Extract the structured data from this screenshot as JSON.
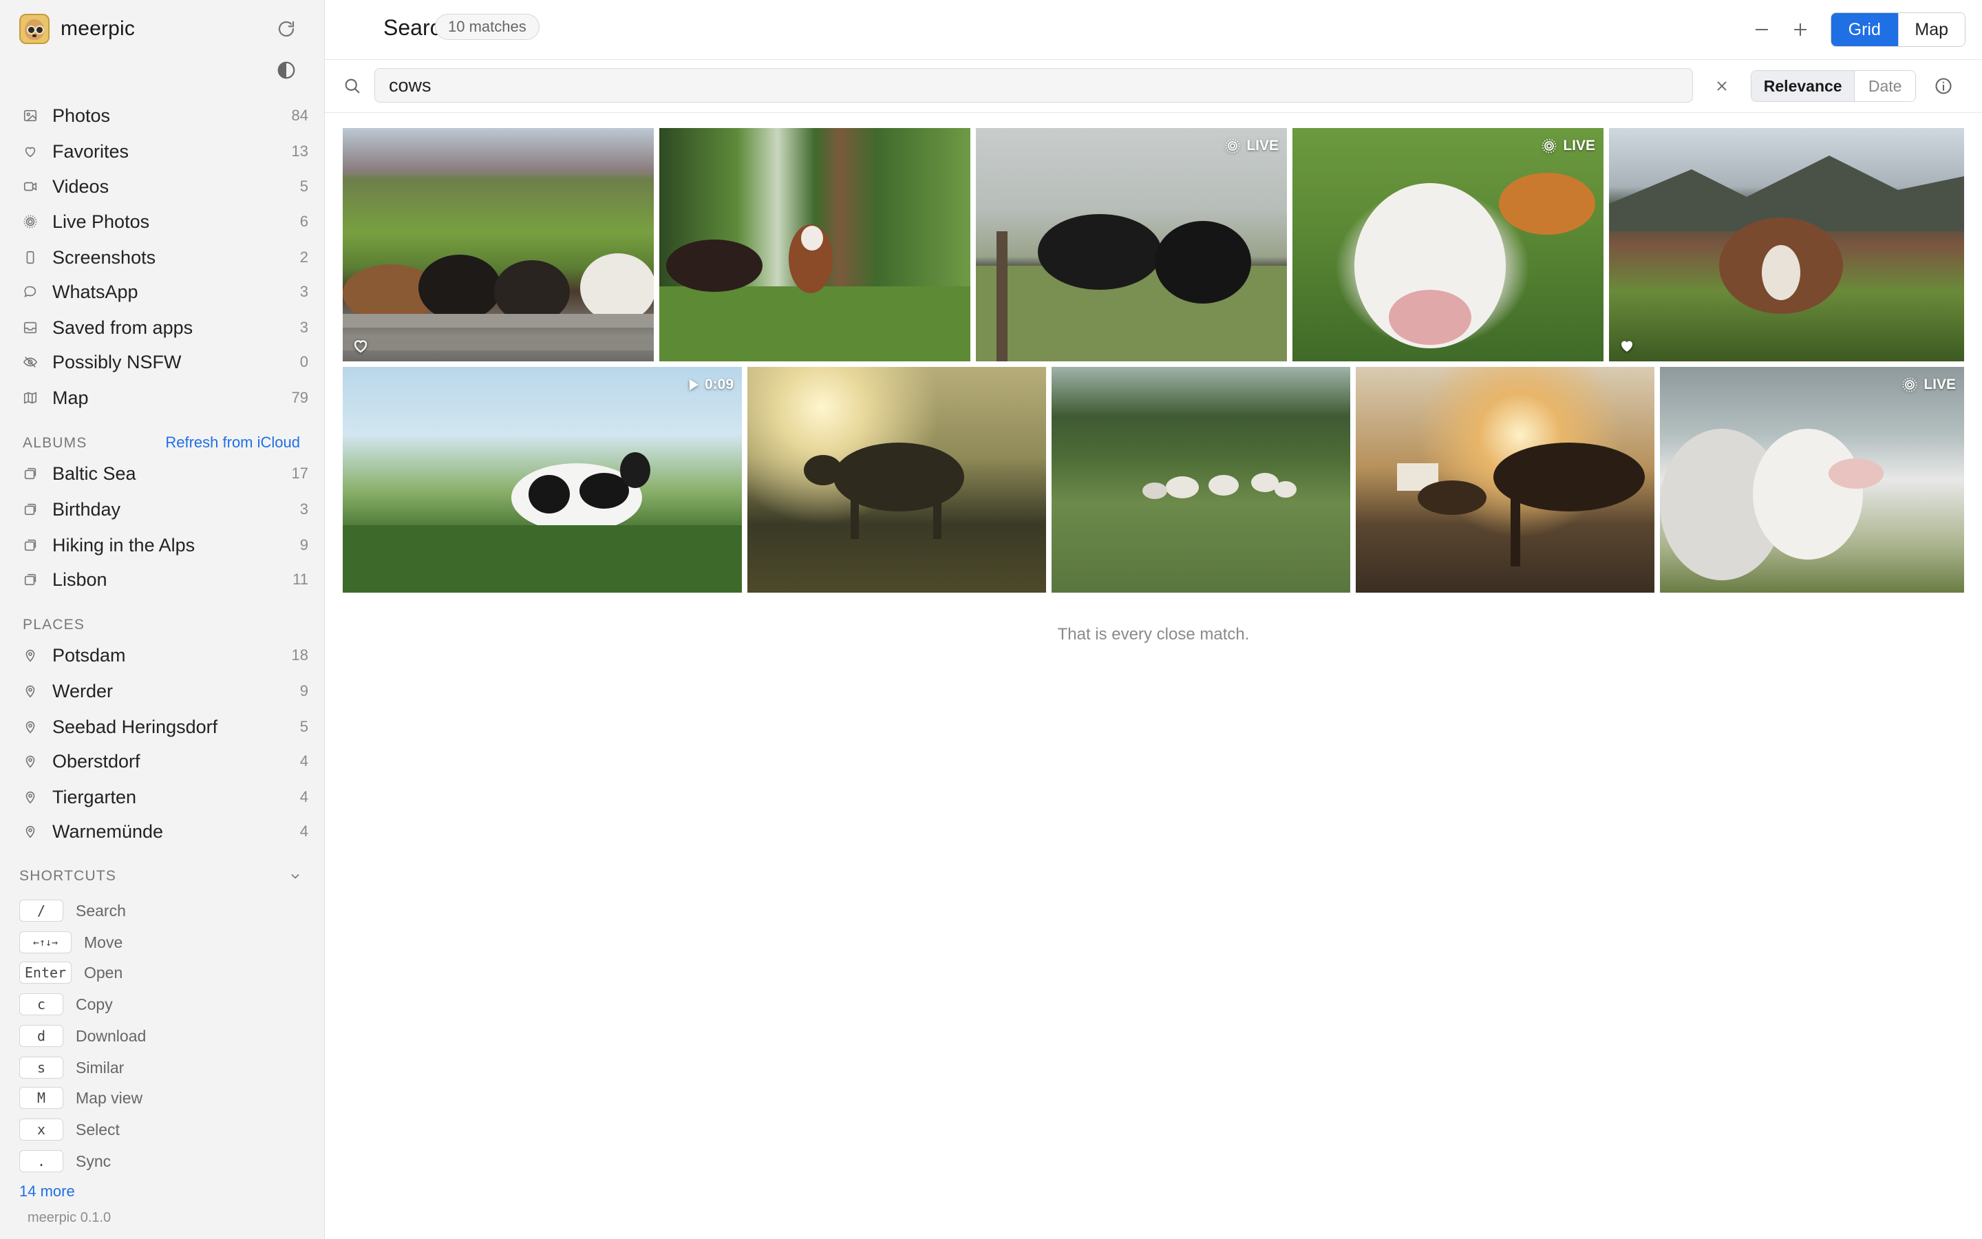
{
  "app": {
    "name": "meerpic",
    "version": "meerpic 0.1.0"
  },
  "library": [
    {
      "label": "Photos",
      "count": "84",
      "icon": "image-icon"
    },
    {
      "label": "Favorites",
      "count": "13",
      "icon": "heart-icon"
    },
    {
      "label": "Videos",
      "count": "5",
      "icon": "video-icon"
    },
    {
      "label": "Live Photos",
      "count": "6",
      "icon": "live-photo-icon"
    },
    {
      "label": "Screenshots",
      "count": "2",
      "icon": "phone-icon"
    },
    {
      "label": "WhatsApp",
      "count": "3",
      "icon": "chat-bubble-icon"
    },
    {
      "label": "Saved from apps",
      "count": "3",
      "icon": "inbox-icon"
    },
    {
      "label": "Possibly NSFW",
      "count": "0",
      "icon": "eye-off-icon"
    },
    {
      "label": "Map",
      "count": "79",
      "icon": "map-icon"
    }
  ],
  "albums": {
    "heading": "ALBUMS",
    "refresh_label": "Refresh from iCloud",
    "items": [
      {
        "label": "Baltic Sea",
        "count": "17"
      },
      {
        "label": "Birthday",
        "count": "3"
      },
      {
        "label": "Hiking in the Alps",
        "count": "9"
      },
      {
        "label": "Lisbon",
        "count": "11"
      }
    ]
  },
  "places": {
    "heading": "PLACES",
    "items": [
      {
        "label": "Potsdam",
        "count": "18"
      },
      {
        "label": "Werder",
        "count": "9"
      },
      {
        "label": "Seebad Heringsdorf",
        "count": "5"
      },
      {
        "label": "Oberstdorf",
        "count": "4"
      },
      {
        "label": "Tiergarten",
        "count": "4"
      },
      {
        "label": "Warnemünde",
        "count": "4"
      }
    ]
  },
  "shortcuts": {
    "heading": "SHORTCUTS",
    "items": [
      {
        "key": "/",
        "label": "Search"
      },
      {
        "key": "←↑↓→",
        "label": "Move"
      },
      {
        "key": "Enter",
        "label": "Open"
      },
      {
        "key": "c",
        "label": "Copy"
      },
      {
        "key": "d",
        "label": "Download"
      },
      {
        "key": "s",
        "label": "Similar"
      },
      {
        "key": "M",
        "label": "Map view"
      },
      {
        "key": "x",
        "label": "Select"
      },
      {
        "key": ".",
        "label": "Sync"
      }
    ],
    "more_label": "14 more"
  },
  "header": {
    "title": "Search",
    "match_count": "10 matches",
    "view_options": [
      "Grid",
      "Map"
    ],
    "active_view": "Grid"
  },
  "search": {
    "query": "cows",
    "sort_options": [
      "Relevance",
      "Date"
    ],
    "active_sort": "Relevance"
  },
  "photos": [
    {
      "subject": "cows behind wooden fence",
      "favorite": true,
      "favorite_style": "outline"
    },
    {
      "subject": "cows in birch forest"
    },
    {
      "subject": "black cows in fog",
      "badge": "LIVE"
    },
    {
      "subject": "cow close-up nose",
      "badge": "LIVE"
    },
    {
      "subject": "cow in alpine meadow",
      "favorite": true,
      "favorite_style": "filled"
    },
    {
      "subject": "black and white cow in grass",
      "badge": "0:09",
      "badge_icon": "play-icon"
    },
    {
      "subject": "cow silhouette at sunrise"
    },
    {
      "subject": "sheep in meadow"
    },
    {
      "subject": "horses at sunset"
    },
    {
      "subject": "lambs close-up",
      "badge": "LIVE"
    }
  ],
  "end_message": "That is every close match.",
  "colors": {
    "accent": "#1f6fe5",
    "sidebar_bg": "#f3f3f3",
    "badge_text": "#ffffff"
  }
}
